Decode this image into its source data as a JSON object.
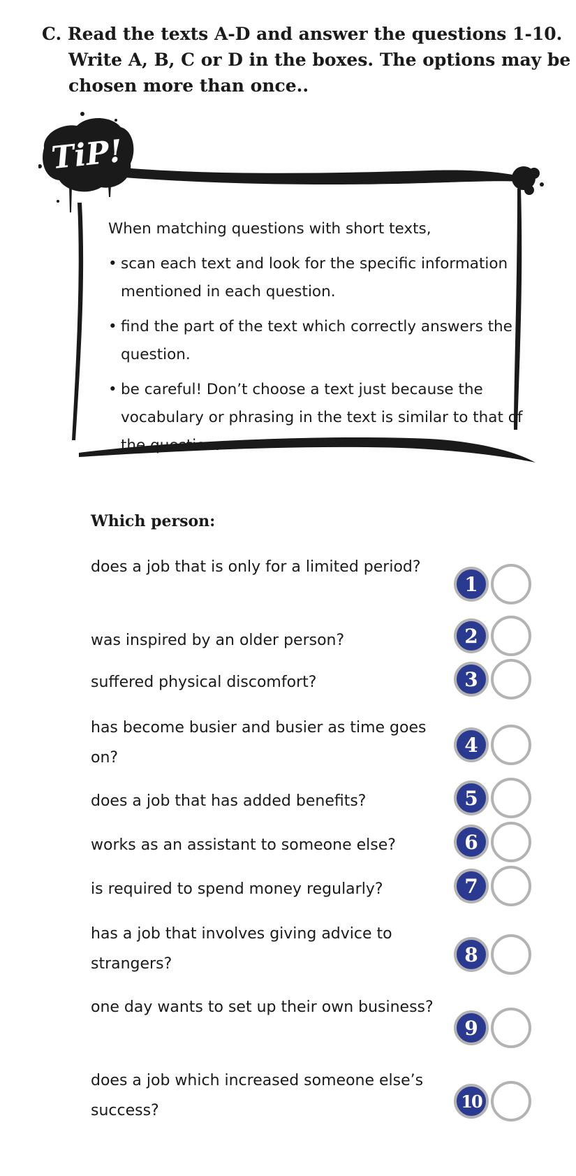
{
  "instruction": "C. Read the texts A-D and answer the questions 1-10. Write A, B, C or D in the boxes. The options may be chosen more than once..",
  "tip": {
    "badge": "TiP!",
    "intro": "When matching questions with short texts,",
    "items": [
      "scan each text and look for the specific information mentioned in each question.",
      "find the part of the text which correctly answers the question.",
      "be careful! Don’t choose a text just because the vocabulary or phrasing in the text is similar to that of the question."
    ]
  },
  "prompt": "Which person:",
  "questions": [
    {
      "number": "1",
      "text": "does a job that is only for a limited period?",
      "answer": ""
    },
    {
      "number": "2",
      "text": "was inspired by an older person?",
      "answer": ""
    },
    {
      "number": "3",
      "text": "suffered physical discomfort?",
      "answer": ""
    },
    {
      "number": "4",
      "text": "has become busier and busier as time goes on?",
      "answer": ""
    },
    {
      "number": "5",
      "text": "does a job that has added benefits?",
      "answer": ""
    },
    {
      "number": "6",
      "text": "works as an assistant to someone else?",
      "answer": ""
    },
    {
      "number": "7",
      "text": "is required to spend money regularly?",
      "answer": ""
    },
    {
      "number": "8",
      "text": "has a job that involves giving advice to strangers?",
      "answer": ""
    },
    {
      "number": "9",
      "text": "one day wants to set up their own business?",
      "answer": ""
    },
    {
      "number": "10",
      "text": "does a job which increased someone else’s success?",
      "answer": ""
    }
  ],
  "colors": {
    "number_fill": "#2a3a91",
    "ring": "#b3b3b3",
    "ink": "#1a1a1a"
  }
}
